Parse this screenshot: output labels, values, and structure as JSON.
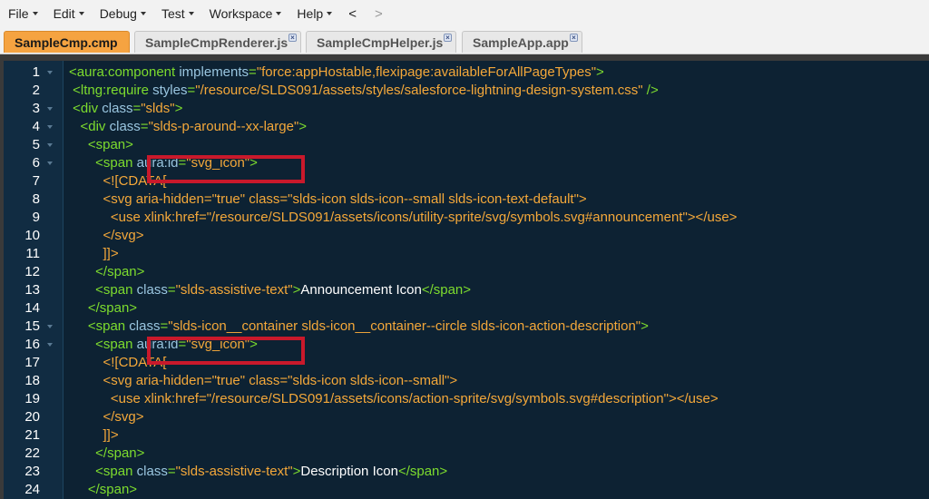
{
  "menu": {
    "items": [
      {
        "label": "File"
      },
      {
        "label": "Edit"
      },
      {
        "label": "Debug"
      },
      {
        "label": "Test"
      },
      {
        "label": "Workspace"
      },
      {
        "label": "Help"
      }
    ],
    "back_arrow": "<",
    "forward_arrow": ">"
  },
  "tabs": [
    {
      "label": "SampleCmp.cmp",
      "active": true
    },
    {
      "label": "SampleCmpRenderer.js",
      "active": false
    },
    {
      "label": "SampleCmpHelper.js",
      "active": false
    },
    {
      "label": "SampleApp.app",
      "active": false
    }
  ],
  "tab_close_glyph": "×",
  "colors": {
    "active_tab": "#f5a341",
    "editor_background": "#0d2233",
    "tag": "#7ddc2e",
    "attribute": "#9ac6e0",
    "value": "#f4a83a",
    "text": "#ffffff",
    "highlight_box": "#c9192b"
  },
  "code_lines": [
    {
      "n": "1",
      "fold": true,
      "tokens": [
        [
          "tag",
          "<aura:component "
        ],
        [
          "attr",
          "implements"
        ],
        [
          "tag",
          "="
        ],
        [
          "val",
          "\"force:appHostable,flexipage:availableForAllPageTypes\""
        ],
        [
          "tag",
          ">"
        ]
      ]
    },
    {
      "n": "2",
      "fold": false,
      "tokens": [
        [
          "tag",
          " <ltng:require "
        ],
        [
          "attr",
          "styles"
        ],
        [
          "tag",
          "="
        ],
        [
          "val",
          "\"/resource/SLDS091/assets/styles/salesforce-lightning-design-system.css\""
        ],
        [
          "tag",
          " />"
        ]
      ]
    },
    {
      "n": "3",
      "fold": true,
      "tokens": [
        [
          "tag",
          " <div "
        ],
        [
          "attr",
          "class"
        ],
        [
          "tag",
          "="
        ],
        [
          "val",
          "\"slds\""
        ],
        [
          "tag",
          ">"
        ]
      ]
    },
    {
      "n": "4",
      "fold": true,
      "tokens": [
        [
          "tag",
          "   <div "
        ],
        [
          "attr",
          "class"
        ],
        [
          "tag",
          "="
        ],
        [
          "val",
          "\"slds-p-around--xx-large\""
        ],
        [
          "tag",
          ">"
        ]
      ]
    },
    {
      "n": "5",
      "fold": true,
      "tokens": [
        [
          "tag",
          "     <span>"
        ]
      ]
    },
    {
      "n": "6",
      "fold": true,
      "tokens": [
        [
          "tag",
          "       <span "
        ],
        [
          "attr",
          "aura:id"
        ],
        [
          "tag",
          "="
        ],
        [
          "val",
          "\"svg_icon\""
        ],
        [
          "tag",
          ">"
        ]
      ]
    },
    {
      "n": "7",
      "fold": false,
      "tokens": [
        [
          "cdata",
          "         <![CDATA["
        ]
      ]
    },
    {
      "n": "8",
      "fold": false,
      "tokens": [
        [
          "cdata",
          "         <svg aria-hidden=\"true\" class=\"slds-icon slds-icon--small slds-icon-text-default\">"
        ]
      ]
    },
    {
      "n": "9",
      "fold": false,
      "tokens": [
        [
          "cdata",
          "           <use xlink:href=\"/resource/SLDS091/assets/icons/utility-sprite/svg/symbols.svg#announcement\"></use>"
        ]
      ]
    },
    {
      "n": "10",
      "fold": false,
      "tokens": [
        [
          "cdata",
          "         </svg>"
        ]
      ]
    },
    {
      "n": "11",
      "fold": false,
      "tokens": [
        [
          "cdata",
          "         ]]>"
        ]
      ]
    },
    {
      "n": "12",
      "fold": false,
      "tokens": [
        [
          "tag",
          "       </span>"
        ]
      ]
    },
    {
      "n": "13",
      "fold": false,
      "tokens": [
        [
          "tag",
          "       <span "
        ],
        [
          "attr",
          "class"
        ],
        [
          "tag",
          "="
        ],
        [
          "val",
          "\"slds-assistive-text\""
        ],
        [
          "tag",
          ">"
        ],
        [
          "txt",
          "Announcement Icon"
        ],
        [
          "tag",
          "</span>"
        ]
      ]
    },
    {
      "n": "14",
      "fold": false,
      "tokens": [
        [
          "tag",
          "     </span>"
        ]
      ]
    },
    {
      "n": "15",
      "fold": true,
      "tokens": [
        [
          "tag",
          "     <span "
        ],
        [
          "attr",
          "class"
        ],
        [
          "tag",
          "="
        ],
        [
          "val",
          "\"slds-icon__container slds-icon__container--circle slds-icon-action-description\""
        ],
        [
          "tag",
          ">"
        ]
      ]
    },
    {
      "n": "16",
      "fold": true,
      "tokens": [
        [
          "tag",
          "       <span "
        ],
        [
          "attr",
          "aura:id"
        ],
        [
          "tag",
          "="
        ],
        [
          "val",
          "\"svg_icon\""
        ],
        [
          "tag",
          ">"
        ]
      ]
    },
    {
      "n": "17",
      "fold": false,
      "tokens": [
        [
          "cdata",
          "         <![CDATA["
        ]
      ]
    },
    {
      "n": "18",
      "fold": false,
      "tokens": [
        [
          "cdata",
          "         <svg aria-hidden=\"true\" class=\"slds-icon slds-icon--small\">"
        ]
      ]
    },
    {
      "n": "19",
      "fold": false,
      "tokens": [
        [
          "cdata",
          "           <use xlink:href=\"/resource/SLDS091/assets/icons/action-sprite/svg/symbols.svg#description\"></use>"
        ]
      ]
    },
    {
      "n": "20",
      "fold": false,
      "tokens": [
        [
          "cdata",
          "         </svg>"
        ]
      ]
    },
    {
      "n": "21",
      "fold": false,
      "tokens": [
        [
          "cdata",
          "         ]]>"
        ]
      ]
    },
    {
      "n": "22",
      "fold": false,
      "tokens": [
        [
          "tag",
          "       </span>"
        ]
      ]
    },
    {
      "n": "23",
      "fold": false,
      "tokens": [
        [
          "tag",
          "       <span "
        ],
        [
          "attr",
          "class"
        ],
        [
          "tag",
          "="
        ],
        [
          "val",
          "\"slds-assistive-text\""
        ],
        [
          "tag",
          ">"
        ],
        [
          "txt",
          "Description Icon"
        ],
        [
          "tag",
          "</span>"
        ]
      ]
    },
    {
      "n": "24",
      "fold": false,
      "tokens": [
        [
          "tag",
          "     </span>"
        ]
      ]
    }
  ]
}
